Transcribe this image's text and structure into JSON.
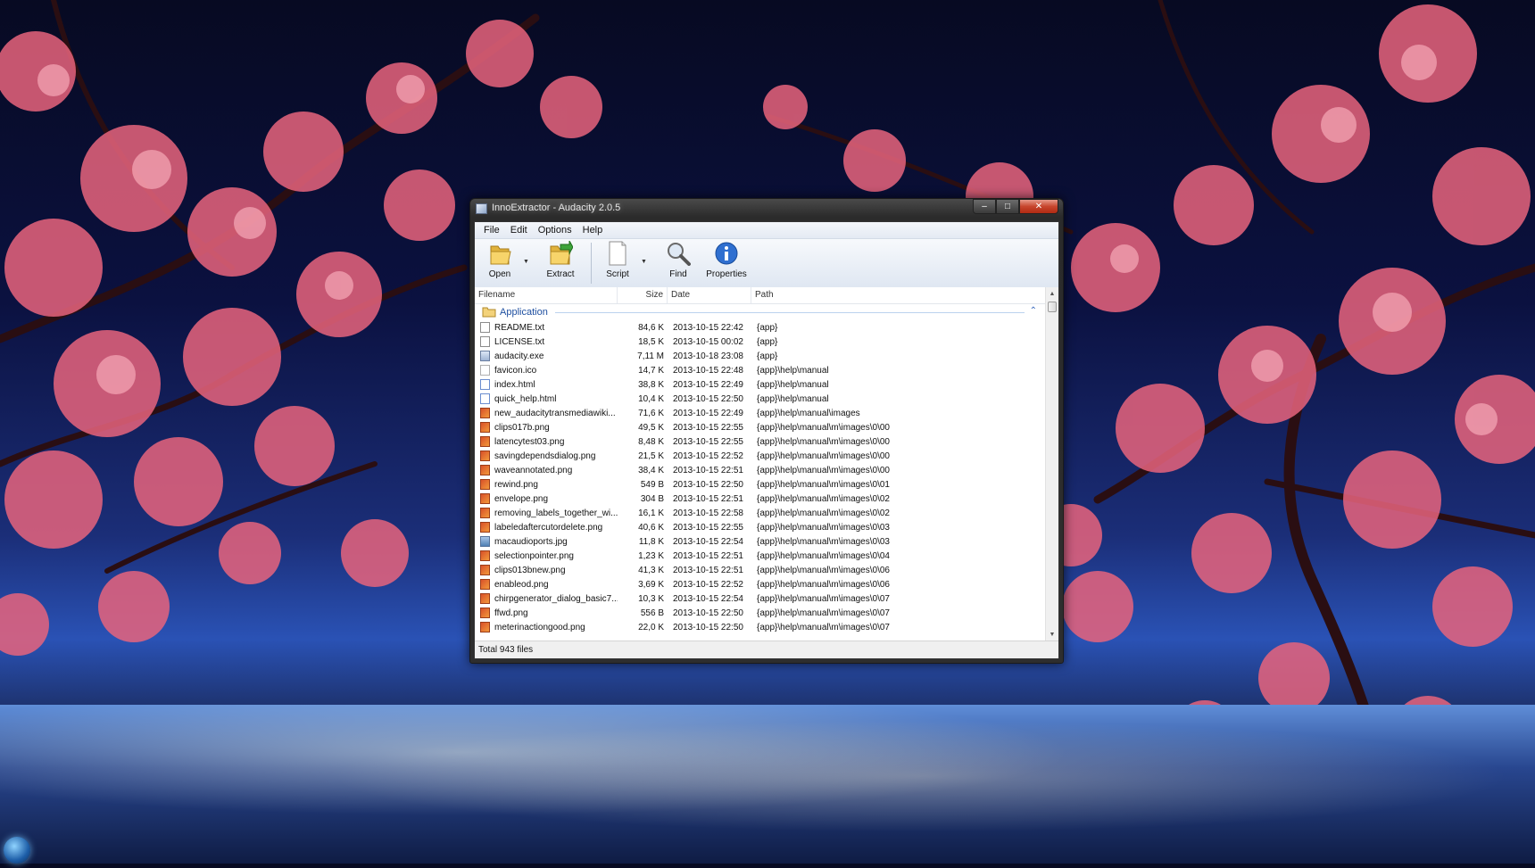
{
  "window": {
    "title": "InnoExtractor - Audacity 2.0.5",
    "caption_buttons": {
      "minimize": "–",
      "maximize": "□",
      "close": "✕"
    }
  },
  "menu": [
    "File",
    "Edit",
    "Options",
    "Help"
  ],
  "toolbar": {
    "open_label": "Open",
    "extract_label": "Extract",
    "script_label": "Script",
    "find_label": "Find",
    "properties_label": "Properties",
    "dropdown_glyph": "▼"
  },
  "columns": {
    "filename": "Filename",
    "size": "Size",
    "date": "Date",
    "path": "Path"
  },
  "group": {
    "title": "Application",
    "caret": "⌃"
  },
  "files": [
    {
      "name": "README.txt",
      "size": "84,6 K",
      "date": "2013-10-15 22:42",
      "path": "{app}",
      "icon": "txt"
    },
    {
      "name": "LICENSE.txt",
      "size": "18,5 K",
      "date": "2013-10-15 00:02",
      "path": "{app}",
      "icon": "txt"
    },
    {
      "name": "audacity.exe",
      "size": "7,11 M",
      "date": "2013-10-18 23:08",
      "path": "{app}",
      "icon": "exe"
    },
    {
      "name": "favicon.ico",
      "size": "14,7 K",
      "date": "2013-10-15 22:48",
      "path": "{app}\\help\\manual",
      "icon": "ico"
    },
    {
      "name": "index.html",
      "size": "38,8 K",
      "date": "2013-10-15 22:49",
      "path": "{app}\\help\\manual",
      "icon": "html"
    },
    {
      "name": "quick_help.html",
      "size": "10,4 K",
      "date": "2013-10-15 22:50",
      "path": "{app}\\help\\manual",
      "icon": "html"
    },
    {
      "name": "new_audacitytransmediawiki...",
      "size": "71,6 K",
      "date": "2013-10-15 22:49",
      "path": "{app}\\help\\manual\\images",
      "icon": "png"
    },
    {
      "name": "clips017b.png",
      "size": "49,5 K",
      "date": "2013-10-15 22:55",
      "path": "{app}\\help\\manual\\m\\images\\0\\00",
      "icon": "png"
    },
    {
      "name": "latencytest03.png",
      "size": "8,48 K",
      "date": "2013-10-15 22:55",
      "path": "{app}\\help\\manual\\m\\images\\0\\00",
      "icon": "png"
    },
    {
      "name": "savingdependsdialog.png",
      "size": "21,5 K",
      "date": "2013-10-15 22:52",
      "path": "{app}\\help\\manual\\m\\images\\0\\00",
      "icon": "png"
    },
    {
      "name": "waveannotated.png",
      "size": "38,4 K",
      "date": "2013-10-15 22:51",
      "path": "{app}\\help\\manual\\m\\images\\0\\00",
      "icon": "png"
    },
    {
      "name": "rewind.png",
      "size": "549 B",
      "date": "2013-10-15 22:50",
      "path": "{app}\\help\\manual\\m\\images\\0\\01",
      "icon": "png"
    },
    {
      "name": "envelope.png",
      "size": "304 B",
      "date": "2013-10-15 22:51",
      "path": "{app}\\help\\manual\\m\\images\\0\\02",
      "icon": "png"
    },
    {
      "name": "removing_labels_together_wi...",
      "size": "16,1 K",
      "date": "2013-10-15 22:58",
      "path": "{app}\\help\\manual\\m\\images\\0\\02",
      "icon": "png"
    },
    {
      "name": "labeledaftercutordelete.png",
      "size": "40,6 K",
      "date": "2013-10-15 22:55",
      "path": "{app}\\help\\manual\\m\\images\\0\\03",
      "icon": "png"
    },
    {
      "name": "macaudioports.jpg",
      "size": "11,8 K",
      "date": "2013-10-15 22:54",
      "path": "{app}\\help\\manual\\m\\images\\0\\03",
      "icon": "jpg"
    },
    {
      "name": "selectionpointer.png",
      "size": "1,23 K",
      "date": "2013-10-15 22:51",
      "path": "{app}\\help\\manual\\m\\images\\0\\04",
      "icon": "png"
    },
    {
      "name": "clips013bnew.png",
      "size": "41,3 K",
      "date": "2013-10-15 22:51",
      "path": "{app}\\help\\manual\\m\\images\\0\\06",
      "icon": "png"
    },
    {
      "name": "enableod.png",
      "size": "3,69 K",
      "date": "2013-10-15 22:52",
      "path": "{app}\\help\\manual\\m\\images\\0\\06",
      "icon": "png"
    },
    {
      "name": "chirpgenerator_dialog_basic7...",
      "size": "10,3 K",
      "date": "2013-10-15 22:54",
      "path": "{app}\\help\\manual\\m\\images\\0\\07",
      "icon": "png"
    },
    {
      "name": "ffwd.png",
      "size": "556 B",
      "date": "2013-10-15 22:50",
      "path": "{app}\\help\\manual\\m\\images\\0\\07",
      "icon": "png"
    },
    {
      "name": "meterinactiongood.png",
      "size": "22,0 K",
      "date": "2013-10-15 22:50",
      "path": "{app}\\help\\manual\\m\\images\\0\\07",
      "icon": "png"
    }
  ],
  "statusbar": {
    "text": "Total 943 files"
  },
  "scrollbar": {
    "up": "▲",
    "down": "▼"
  }
}
